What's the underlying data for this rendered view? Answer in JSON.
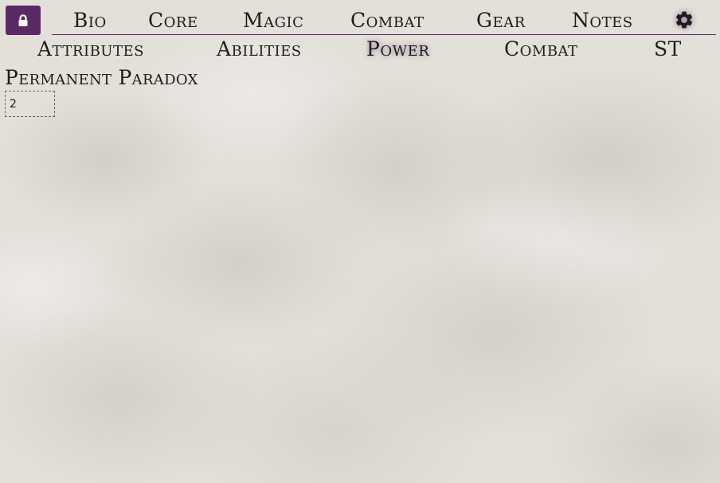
{
  "toolbar": {
    "lock_icon": "lock-icon",
    "settings_icon": "gear-icon",
    "accent_color": "#5b2a66"
  },
  "tabs": [
    {
      "label": "Bio"
    },
    {
      "label": "Core"
    },
    {
      "label": "Magic"
    },
    {
      "label": "Combat"
    },
    {
      "label": "Gear"
    },
    {
      "label": "Notes"
    }
  ],
  "subtabs": [
    {
      "label": "Attributes"
    },
    {
      "label": "Abilities"
    },
    {
      "label": "Power",
      "active": true
    },
    {
      "label": "Combat"
    },
    {
      "label": "ST"
    }
  ],
  "fields": {
    "permanent_paradox": {
      "label": "Permanent Paradox",
      "value": "2"
    }
  }
}
